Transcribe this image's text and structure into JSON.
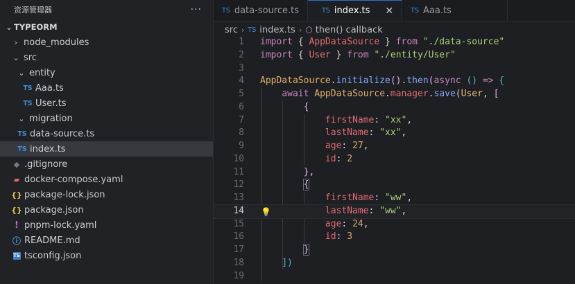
{
  "explorer": {
    "title": "资源管理器",
    "more": "···",
    "root": "TYPEORM",
    "items": [
      {
        "label": "node_modules",
        "kind": "folder"
      },
      {
        "label": "src",
        "kind": "folder"
      },
      {
        "label": "entity",
        "kind": "folder"
      },
      {
        "label": "Aaa.ts",
        "kind": "ts"
      },
      {
        "label": "User.ts",
        "kind": "ts"
      },
      {
        "label": "migration",
        "kind": "folder"
      },
      {
        "label": "data-source.ts",
        "kind": "ts"
      },
      {
        "label": "index.ts",
        "kind": "ts"
      },
      {
        "label": ".gitignore",
        "kind": "git"
      },
      {
        "label": "docker-compose.yaml",
        "kind": "docker"
      },
      {
        "label": "package-lock.json",
        "kind": "json"
      },
      {
        "label": "package.json",
        "kind": "json"
      },
      {
        "label": "pnpm-lock.yaml",
        "kind": "yaml"
      },
      {
        "label": "README.md",
        "kind": "info"
      },
      {
        "label": "tsconfig.json",
        "kind": "tsconfig"
      }
    ]
  },
  "tabs": [
    {
      "label": "data-source.ts",
      "icon": "TS"
    },
    {
      "label": "index.ts",
      "icon": "TS",
      "close": "✕"
    },
    {
      "label": "Aaa.ts",
      "icon": "TS"
    }
  ],
  "breadcrumb": {
    "root": "src",
    "file": "index.ts",
    "symbol": "then() callback",
    "file_icon": "TS"
  },
  "code": {
    "line_numbers": [
      "1",
      "2",
      "3",
      "4",
      "5",
      "6",
      "7",
      "8",
      "9",
      "10",
      "11",
      "12",
      "13",
      "14",
      "15",
      "16",
      "17",
      "18",
      "19"
    ],
    "current_line": 14,
    "l1": {
      "import": "import",
      "ob": "{",
      "name": "AppDataSource",
      "cb": "}",
      "from": "from",
      "path": "\"./data-source\""
    },
    "l2": {
      "import": "import",
      "ob": "{",
      "name": "User",
      "cb": "}",
      "from": "from",
      "path": "\"./entity/User\""
    },
    "l4": {
      "obj": "AppDataSource",
      "dot1": ".",
      "init": "initialize",
      "p1": "()",
      "dot2": ".",
      "then": "then",
      "op": "(",
      "async": "async",
      "args": "()",
      "arrow": "=>",
      "ob": "{"
    },
    "l5": {
      "await": "await",
      "obj": "AppDataSource",
      "dot1": ".",
      "manager": "manager",
      "dot2": ".",
      "save": "save",
      "op": "(",
      "cls": "User",
      "comma": ",",
      "sb": "["
    },
    "l6": {
      "ob": "{"
    },
    "l7": {
      "key": "firstName",
      "colon": ":",
      "val": "\"xx\"",
      "comma": ","
    },
    "l8": {
      "key": "lastName",
      "colon": ":",
      "val": "\"xx\"",
      "comma": ","
    },
    "l9": {
      "key": "age",
      "colon": ":",
      "val": "27",
      "comma": ","
    },
    "l10": {
      "key": "id",
      "colon": ":",
      "val": "2"
    },
    "l11": {
      "cb": "},"
    },
    "l12": {
      "ob": "{"
    },
    "l13": {
      "key": "firstName",
      "colon": ":",
      "val": "\"ww\"",
      "comma": ","
    },
    "l14": {
      "key": "lastName",
      "colon": ":",
      "val": "\"ww\"",
      "comma": ","
    },
    "l15": {
      "key": "age",
      "colon": ":",
      "val": "24",
      "comma": ","
    },
    "l16": {
      "key": "id",
      "colon": ":",
      "val": "3"
    },
    "l17": {
      "cb": "}"
    },
    "l18": {
      "close": "])"
    }
  },
  "colors": {
    "accent": "#2f6fd0",
    "ts": "#3c8fd6",
    "json": "#e5c04a"
  }
}
